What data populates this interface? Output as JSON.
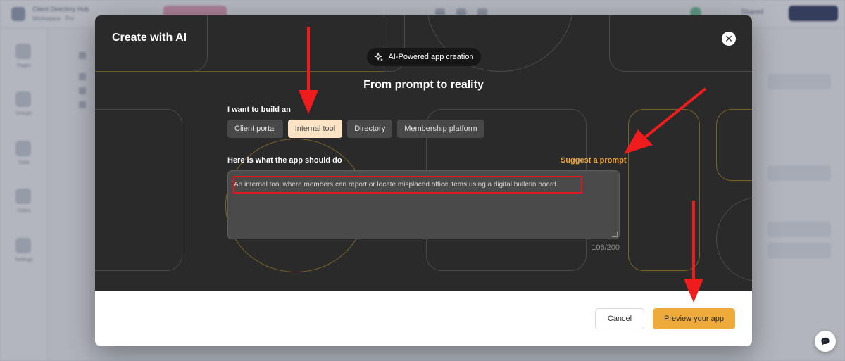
{
  "background_app": {
    "title": "Client Directory Hub",
    "subtitle": "Workspace · Pro",
    "share_label": "Shared",
    "sidebar_items": [
      "Pages",
      "Groups",
      "Data",
      "Users",
      "Settings"
    ]
  },
  "modal": {
    "title": "Create with AI",
    "badge": "AI-Powered app creation",
    "headline": "From prompt to reality",
    "build_label": "I want to build an",
    "options": [
      {
        "label": "Client portal",
        "selected": false
      },
      {
        "label": "Internal tool",
        "selected": true
      },
      {
        "label": "Directory",
        "selected": false
      },
      {
        "label": "Membership platform",
        "selected": false
      }
    ],
    "description_label": "Here is what the app should do",
    "suggest_label": "Suggest a prompt",
    "description_value": "An internal tool where members can report or locate misplaced office items using a digital bulletin board.",
    "char_count": "106/200",
    "cancel_label": "Cancel",
    "preview_label": "Preview your app"
  },
  "colors": {
    "accent": "#eeaa3a",
    "dark_panel": "#2a2a2a",
    "selected_chip": "#fbe3c4",
    "annotation": "#e0171b"
  },
  "icons": {
    "close": "close-icon",
    "badge": "sparkles-icon",
    "chat": "chat-icon"
  }
}
